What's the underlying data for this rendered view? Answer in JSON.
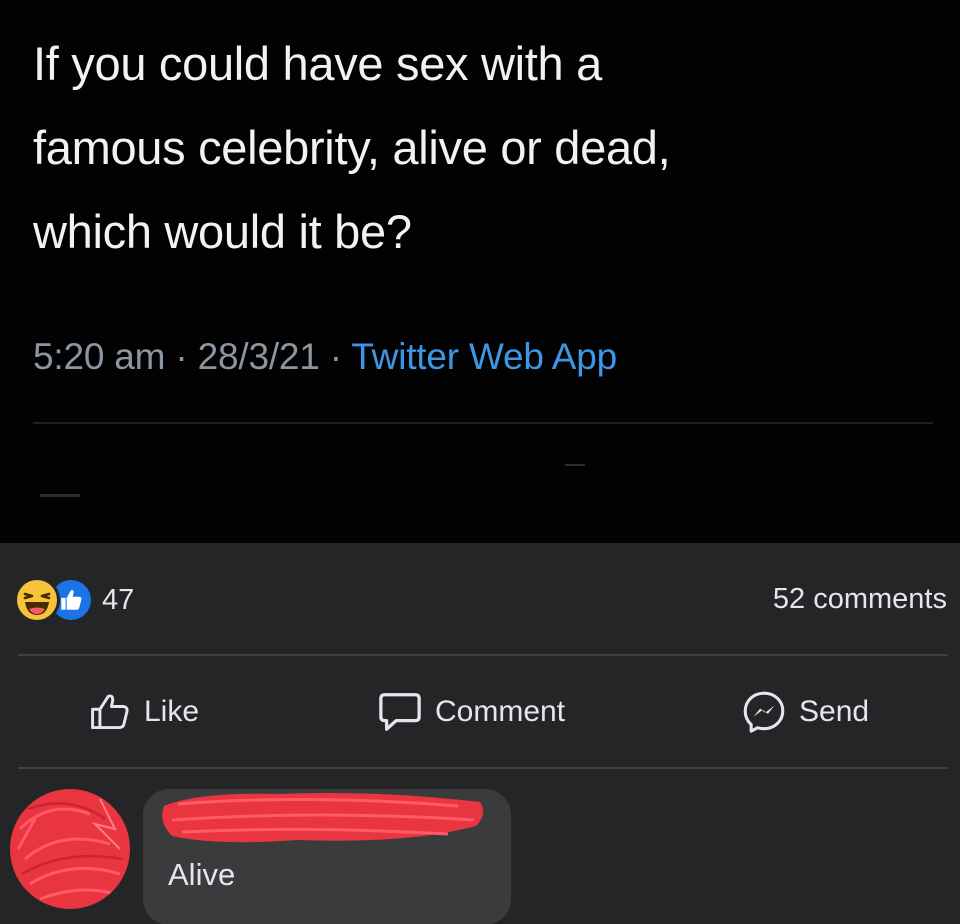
{
  "tweet": {
    "text_lines": [
      "If you could have sex with a",
      "famous celebrity, alive or dead,",
      "which would it be?"
    ],
    "time": "5:20 am",
    "separator": "·",
    "date": "28/3/21",
    "source": "Twitter Web App"
  },
  "post": {
    "reaction_count": "47",
    "comments_count": "52 comments",
    "reactions": [
      "haha-icon",
      "like-icon"
    ]
  },
  "actions": {
    "like_label": "Like",
    "comment_label": "Comment",
    "send_label": "Send"
  },
  "comment": {
    "text": "Alive"
  },
  "colors": {
    "fb_background": "#242526",
    "tweet_background": "#020203",
    "twitter_link": "#3e96e6",
    "redaction": "#e8353f",
    "like_blue": "#1b74e4",
    "haha_yellow": "#f7c33b"
  }
}
